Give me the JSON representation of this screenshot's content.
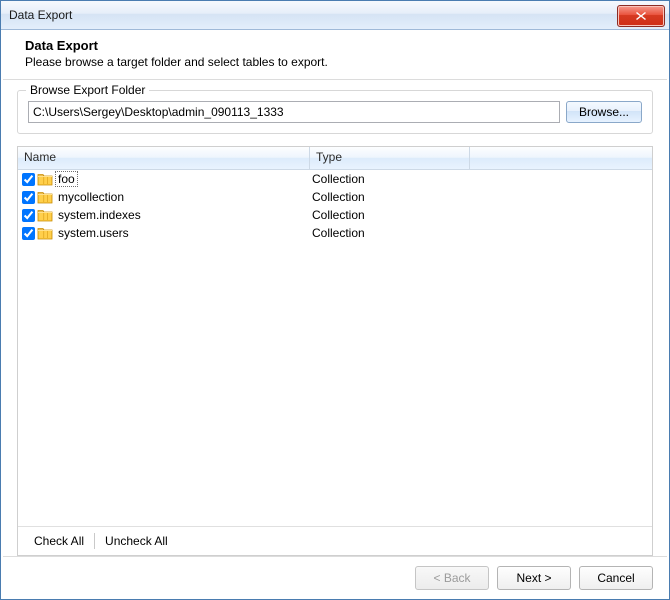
{
  "window": {
    "title": "Data Export"
  },
  "header": {
    "title": "Data Export",
    "subtitle": "Please browse a target folder and select tables to export."
  },
  "browse": {
    "legend": "Browse Export Folder",
    "path": "C:\\Users\\Sergey\\Desktop\\admin_090113_1333",
    "button": "Browse..."
  },
  "table": {
    "columns": {
      "name": "Name",
      "type": "Type"
    },
    "rows": [
      {
        "checked": true,
        "name": "foo",
        "type": "Collection",
        "focused": true
      },
      {
        "checked": true,
        "name": "mycollection",
        "type": "Collection",
        "focused": false
      },
      {
        "checked": true,
        "name": "system.indexes",
        "type": "Collection",
        "focused": false
      },
      {
        "checked": true,
        "name": "system.users",
        "type": "Collection",
        "focused": false
      }
    ]
  },
  "tableFooter": {
    "checkAll": "Check All",
    "uncheckAll": "Uncheck All"
  },
  "buttons": {
    "back": "< Back",
    "next": "Next >",
    "cancel": "Cancel"
  }
}
